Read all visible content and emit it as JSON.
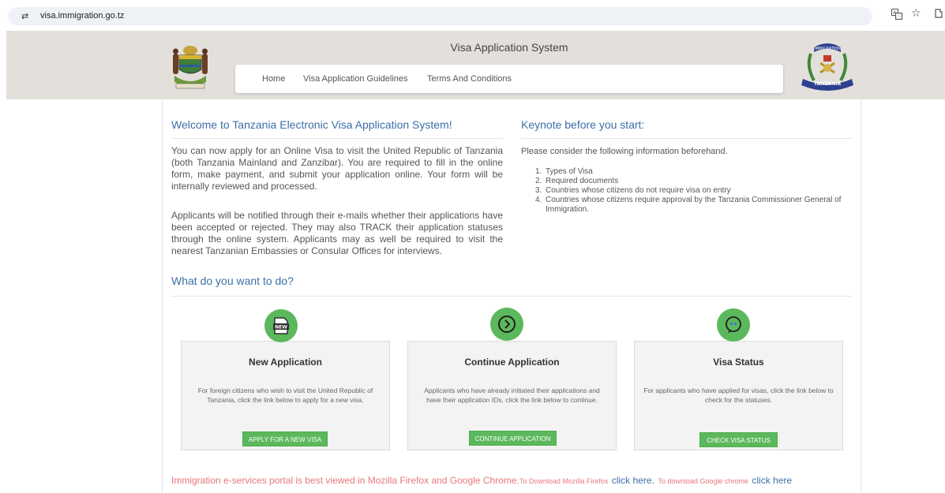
{
  "browser": {
    "url": "visa.immigration.go.tz"
  },
  "header": {
    "system_title": "Visa Application System",
    "nav": [
      {
        "label": "Home"
      },
      {
        "label": "Visa Application Guidelines"
      },
      {
        "label": "Terms And Conditions"
      }
    ],
    "logo_text": "IMMIGRATION",
    "logo_banner": "TANZANIA"
  },
  "welcome": {
    "title": "Welcome to Tanzania Electronic Visa Application System!",
    "paragraph1": "You can now apply for an Online Visa to visit the United Republic of Tanzania (both Tanzania Mainland and Zanzibar). You are required to fill in the online form, make payment, and submit your application online. Your form will be internally reviewed and processed.",
    "paragraph2": "Applicants will be notified through their e-mails whether their applications have been accepted or rejected. They may also TRACK their application statuses through the online system. Applicants may as well be required to visit the nearest Tanzanian Embassies or Consular Offices for interviews."
  },
  "keynote": {
    "title": "Keynote before you start:",
    "intro": "Please consider the following information beforehand.",
    "items": [
      {
        "num": "1.",
        "text": "Types of Visa"
      },
      {
        "num": "2.",
        "text": "Required documents"
      },
      {
        "num": "3.",
        "text": "Countries whose citizens do not require visa on entry"
      },
      {
        "num": "4.",
        "text": "Countries whose citizens require approval by the Tanzania Commissioner General of Immigration."
      }
    ]
  },
  "actions": {
    "title": "What do you want to do?",
    "cards": [
      {
        "title": "New Application",
        "description": "For foreign citizens who wish to visit the United Republic of Tanzania, click the link below to apply for a new visa.",
        "button": "APPLY FOR A NEW VISA",
        "icon_text": "NEW"
      },
      {
        "title": "Continue Application",
        "description": "Applicants who have already initiated their applications and have their application IDs, click the link below to continue.",
        "button": "CONTINUE APPLICATION"
      },
      {
        "title": "Visa Status",
        "description": "For applicants who have applied for visas, click the link below to check for the statuses.",
        "button": "CHECK VISA STATUS"
      }
    ]
  },
  "footer": {
    "note": "Immigration e-services portal is best viewed in Mozilla Firefox and Google Chrome.",
    "firefox_prefix": "To Download Mozilla Firefox",
    "firefox_link": "click here.",
    "chrome_prefix": "To download Google chrome",
    "chrome_link": "click here"
  },
  "colors": {
    "accent_green": "#5cb85c",
    "heading_blue": "#3d6fa6",
    "header_band": "#e3dfdb",
    "footer_red": "#e8777a"
  }
}
